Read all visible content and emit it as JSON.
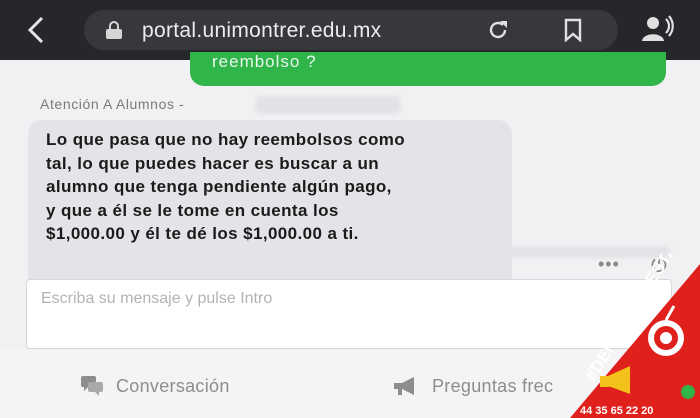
{
  "browser": {
    "url": "portal.unimontrer.edu.mx"
  },
  "chat": {
    "previous_message_fragment": "reembolso ?",
    "agent_label": "Atención A Alumnos -",
    "agent_message_lines": [
      "Lo que pasa que no hay reembolsos como",
      "tal, lo que puedes hacer es buscar a un",
      "alumno que tenga pendiente algún pago,",
      "y que a él se le tome en cuenta los",
      "$1,000.00 y él te dé los $1,000.00 a ti."
    ],
    "more_options": "•••",
    "input_placeholder": "Escriba su mensaje y pulse Intro"
  },
  "tabs": {
    "conversation": "Conversación",
    "faq": "Preguntas frec"
  },
  "watermark": {
    "brand": "#DENUNCIAMESTA",
    "phone": "44 35 65 22 20",
    "accent": "#e0201c"
  },
  "colors": {
    "topbar": "#26272b",
    "sent_bubble": "#2fb54a",
    "received_bubble": "#e4e4e8"
  }
}
